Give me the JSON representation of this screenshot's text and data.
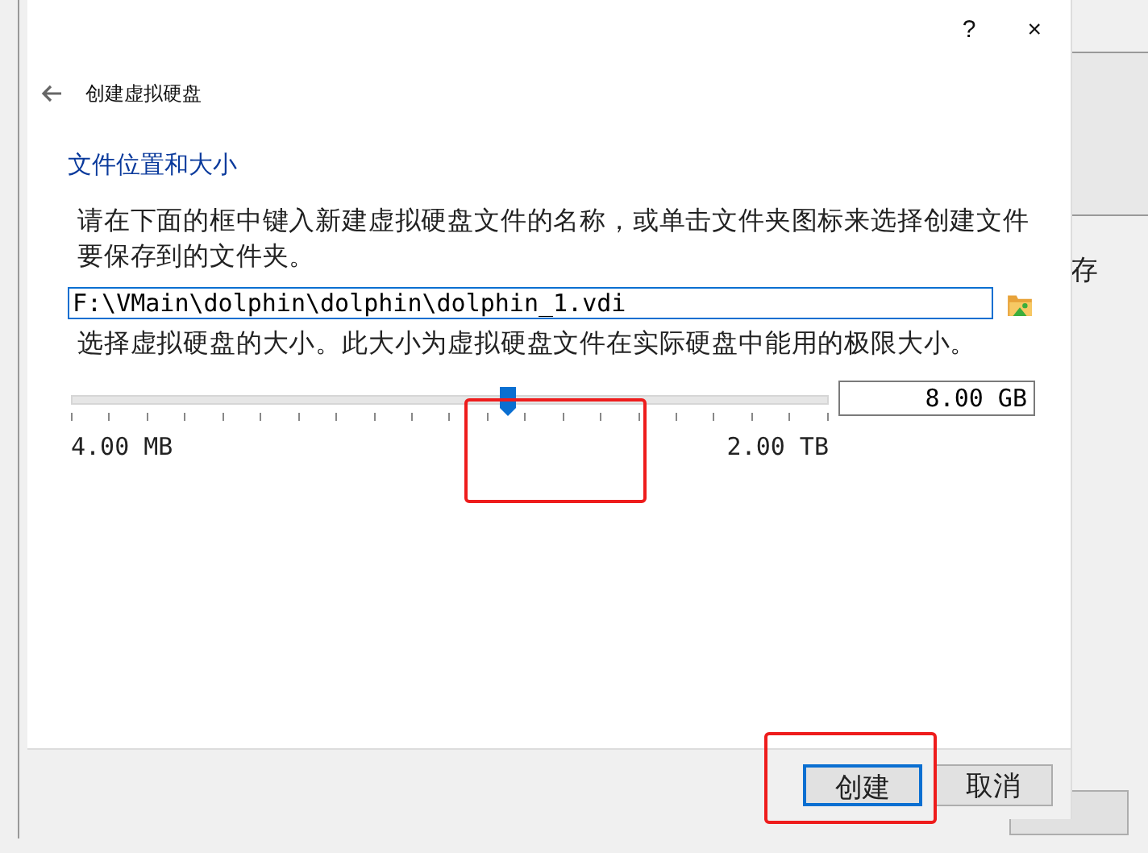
{
  "background_window": {
    "side_text": "存"
  },
  "dialog": {
    "help": "?",
    "close": "×",
    "title": "创建虚拟硬盘",
    "section": "文件位置和大小",
    "location_hint": "请在下面的框中键入新建虚拟硬盘文件的名称，或单击文件夹图标来选择创建文件要保存到的文件夹。",
    "location": {
      "value": "F:\\VMain\\dolphin\\dolphin\\dolphin_1.vdi"
    },
    "size_hint": "选择虚拟硬盘的大小。此大小为虚拟硬盘文件在实际硬盘中能用的极限大小。",
    "size_slider": {
      "level": 0.576,
      "min_label": "4.00 MB",
      "max_label": "2.00 TB",
      "highlighted": true
    },
    "size": {
      "value": "8.00 GB"
    },
    "buttons": [
      {
        "label": "创建",
        "default": true,
        "highlighted": true
      },
      {
        "label": "取消",
        "default": false,
        "highlighted": false
      }
    ]
  }
}
